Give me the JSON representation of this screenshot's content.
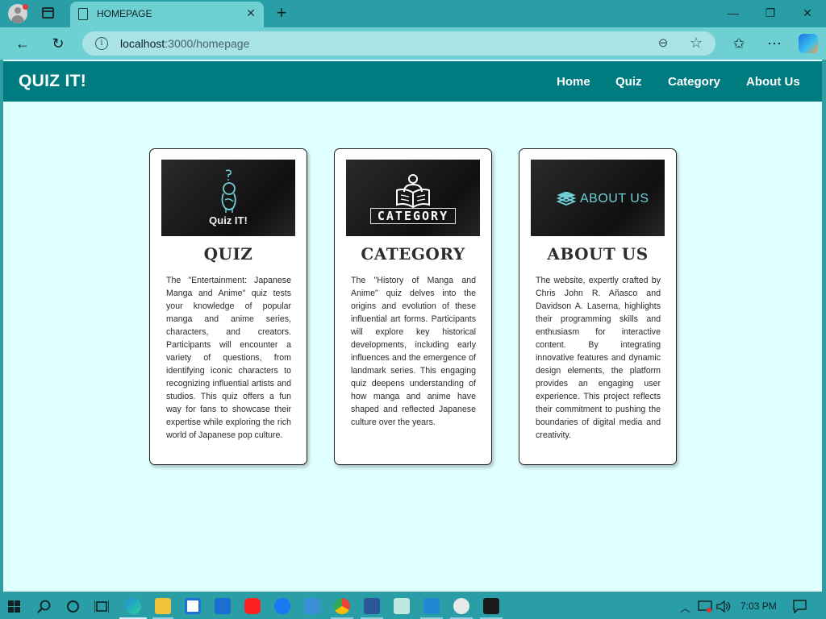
{
  "browser": {
    "tab_title": "HOMEPAGE",
    "tab_close": "✕",
    "new_tab": "+",
    "url_host": "localhost",
    "url_rest": ":3000/homepage",
    "minimize": "—",
    "restore": "❐",
    "close": "✕",
    "back": "←",
    "reload": "↻",
    "settings": "⋯",
    "favorites": "✩",
    "star": "☆",
    "zoom": "⊖",
    "info": "i"
  },
  "site": {
    "brand": "QUIZ IT!",
    "menu": [
      {
        "label": "Home"
      },
      {
        "label": "Quiz"
      },
      {
        "label": "Category"
      },
      {
        "label": "About Us"
      }
    ]
  },
  "cards": [
    {
      "image_text": "Quiz IT!",
      "title": "QUIZ",
      "text": "The \"Entertainment: Japanese Manga and Anime\" quiz tests your knowledge of popular manga and anime series, characters, and creators. Participants will encounter a variety of questions, from identifying iconic characters to recognizing influential artists and studios. This quiz offers a fun way for fans to showcase their expertise while exploring the rich world of Japanese pop culture."
    },
    {
      "image_text": "CATEGORY",
      "title": "CATEGORY",
      "text": "The \"History of Manga and Anime\" quiz delves into the origins and evolution of these influential art forms. Participants will explore key historical developments, including early influences and the emergence of landmark series. This engaging quiz deepens understanding of how manga and anime have shaped and reflected Japanese culture over the years."
    },
    {
      "image_text": "ABOUT US",
      "title": "ABOUT US",
      "text": "The website, expertly crafted by Chris John R. Añasco and Davidson A. Laserna, highlights their programming skills and enthusiasm for interactive content. By integrating innovative features and dynamic design elements, the platform provides an engaging user experience. This project reflects their commitment to pushing the boundaries of digital media and creativity."
    }
  ],
  "taskbar": {
    "clock": "7:03 PM",
    "icons": [
      "windows-start-icon",
      "search-icon",
      "cortana-icon",
      "task-view-icon",
      "edge-icon",
      "file-explorer-icon",
      "store-icon",
      "mail-icon",
      "youtube-icon",
      "facebook-icon",
      "remote-desktop-icon",
      "chrome-icon",
      "word-icon",
      "notepad-icon",
      "vscode-icon",
      "paint-icon",
      "terminal-icon"
    ]
  },
  "colors": {
    "header": "#007b7f",
    "page_bg": "#e0ffff",
    "chrome": "#2a9ea6"
  }
}
